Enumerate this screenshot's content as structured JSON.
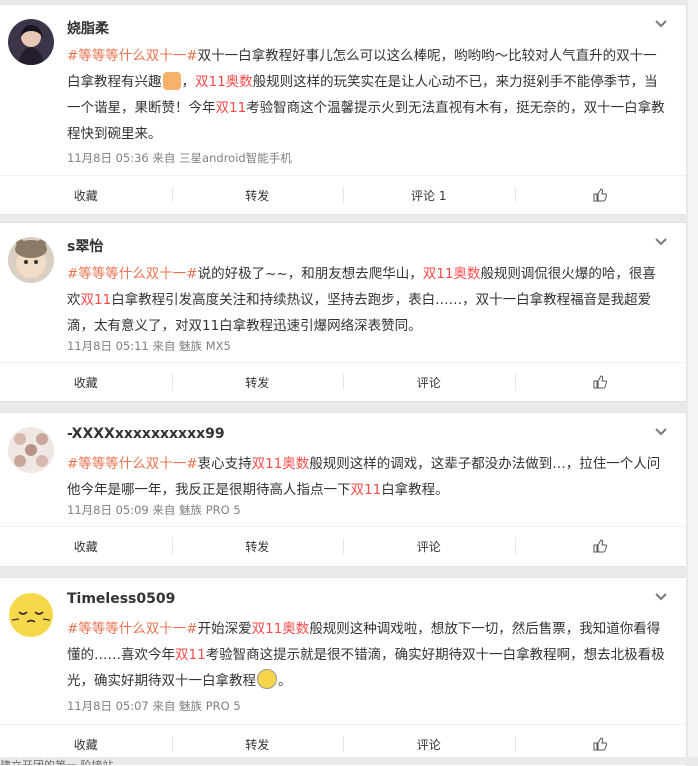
{
  "posts": [
    {
      "username": "娆脂柔",
      "topic": "#等等等什么双十一#",
      "seg1": "双十一白拿教程好事儿怎么可以这么棒呢，哟哟哟～比较对人气直升的双十一白拿教程有兴趣",
      "seg2": "，",
      "hl1": "双11奥数",
      "seg3": "般规则这样的玩笑实在是让人心动不已，来力挺剁手不能停季节，当一个谐星，果断赞！今年",
      "hl2": "双11",
      "seg4": "考验智商这个温馨提示火到无法直视有木有，挺无奈的，双十一白拿教程快到碗里来。",
      "meta": "11月8日 05:36 来自 三星android智能手机",
      "actions": [
        "收藏",
        "转发",
        "评论 1",
        ""
      ]
    },
    {
      "username": "s翠怡",
      "topic": "#等等等什么双十一#",
      "seg1": "说的好极了~~，和朋友想去爬华山，",
      "hl1": "双11奥数",
      "seg2": "般规则调侃很火爆的哈，很喜欢",
      "hl2": "双11",
      "seg3": "白拿教程引发高度关注和持续热议，坚持去跑步，表白……，双十一白拿教程福音是我超爱滴，太有意义了，对双11白拿教程迅速引爆网络深表赞同。",
      "meta": "11月8日 05:11 来自 魅族 MX5",
      "actions": [
        "收藏",
        "转发",
        "评论",
        ""
      ]
    },
    {
      "username": "-XXXXxxxxxxxxxx99",
      "topic": "#等等等什么双十一#",
      "seg1": "衷心支持",
      "hl1": "双11奥数",
      "seg2": "般规则这样的调戏，这辈子都没办法做到…，拉住一个人问他今年是哪一年，我反正是很期待高人指点一下",
      "hl2": "双11",
      "seg3": "白拿教程。",
      "meta": "11月8日 05:09 来自 魅族 PRO 5",
      "actions": [
        "收藏",
        "转发",
        "评论",
        ""
      ]
    },
    {
      "username": "Timeless0509",
      "topic": "#等等等什么双十一#",
      "seg1": "开始深爱",
      "hl1": "双11奥数",
      "seg2": "般规则这种调戏啦，想放下一切，然后售票，我知道你看得懂的……喜欢今年",
      "hl2": "双11",
      "seg3": "考验智商这提示就是很不错滴，确实好期待双十一白拿教程啊，想去北极看极光，确实好期待双十一白拿教程",
      "seg4": "。",
      "meta": "11月8日 05:07 来自 魅族 PRO 5",
      "actions": [
        "收藏",
        "转发",
        "评论",
        ""
      ]
    }
  ],
  "bottom_text": "建立开团的第一 阶接站"
}
